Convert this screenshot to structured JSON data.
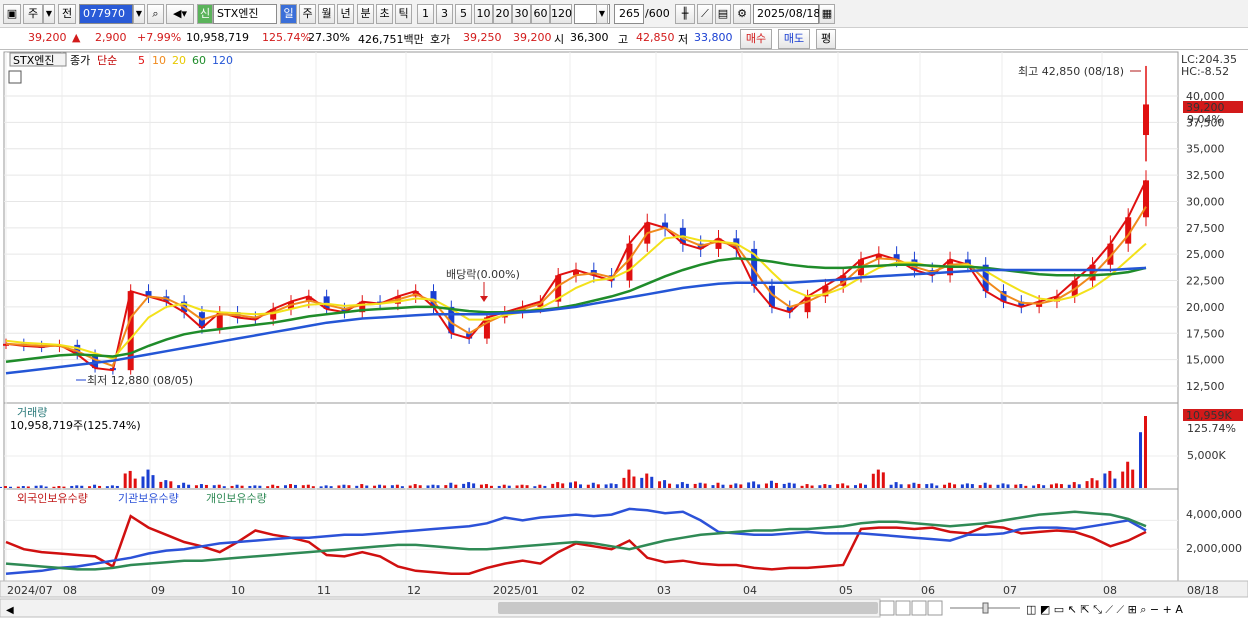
{
  "toolbar": {
    "period_labels": [
      "주",
      "전"
    ],
    "code": "077970",
    "badge": "신",
    "stock_name": "STX엔진",
    "timeframes": [
      "일",
      "주",
      "월",
      "년",
      "분",
      "초",
      "틱"
    ],
    "intervals": [
      "1",
      "3",
      "5",
      "10",
      "20",
      "30",
      "60",
      "120"
    ],
    "count": "265",
    "count_max": "/600",
    "date": "2025/08/18"
  },
  "quote": {
    "price": "39,200",
    "change": "2,900",
    "change_pct": "+7.99%",
    "volume": "10,958,719",
    "volume_ratio": "125.74%",
    "turnover": "27.30%",
    "amount": "426,751백만",
    "bid_label": "호가",
    "bid1": "39,250",
    "bid2": "39,200",
    "open_label": "시",
    "open": "36,300",
    "high_label": "고",
    "high": "42,850",
    "low_label": "저",
    "low": "33,800",
    "buy_label": "매수",
    "sell_label": "매도",
    "eval_label": "평"
  },
  "colors": {
    "ma5": "#e01010",
    "ma10": "#f08a1c",
    "ma20": "#f3e11a",
    "ma60": "#1f8c2a",
    "ma120": "#2456d6",
    "foreign": "#d01010",
    "institution": "#2c52d8",
    "individual": "#2f8a55",
    "up": "#e01010",
    "down": "#1a3fd2"
  },
  "chart_data": [
    {
      "type": "line",
      "title": "STX엔진",
      "legend": [
        "종가",
        "단순",
        "5",
        "10",
        "20",
        "60",
        "120"
      ],
      "price_label_right": "39,200",
      "pct_label_right": "9.04%",
      "lc_label": "LC:204.35",
      "hc_label": "HC:-8.52",
      "y_ticks": [
        "40,000",
        "37,500",
        "35,000",
        "32,500",
        "30,000",
        "27,500",
        "25,000",
        "22,500",
        "20,000",
        "17,500",
        "15,000",
        "12,500"
      ],
      "ylim": [
        10000,
        44000
      ],
      "annotations": {
        "high": "최고 42,850 (08/18)",
        "low": "최저 12,880 (08/05)",
        "dividend": "배당락(0.00%)"
      },
      "x_ticks": [
        "2024/07",
        "08",
        "09",
        "10",
        "11",
        "12",
        "2025/01",
        "02",
        "03",
        "04",
        "05",
        "06",
        "07",
        "08",
        "08/18"
      ],
      "series": [
        {
          "name": "5",
          "values": [
            16500,
            16300,
            16200,
            16400,
            15500,
            14200,
            14000,
            21500,
            21000,
            20500,
            19500,
            18000,
            19500,
            19000,
            18800,
            19800,
            20500,
            21000,
            19800,
            19500,
            20500,
            20300,
            21000,
            21500,
            20000,
            17500,
            17000,
            19000,
            19500,
            20000,
            20500,
            23000,
            23500,
            23000,
            22500,
            26000,
            28000,
            27500,
            26000,
            25500,
            26500,
            25500,
            22000,
            20000,
            19500,
            21000,
            22000,
            23000,
            24500,
            25000,
            24500,
            23500,
            23000,
            24500,
            24000,
            21500,
            20500,
            20000,
            20500,
            21000,
            22500,
            24000,
            26000,
            28500,
            32000
          ]
        },
        {
          "name": "10",
          "values": [
            16500,
            16400,
            16300,
            16300,
            15800,
            15000,
            14400,
            19000,
            21000,
            20800,
            20000,
            18800,
            19300,
            19200,
            19000,
            19500,
            20200,
            20600,
            20200,
            19800,
            20200,
            20300,
            20700,
            21200,
            20500,
            18500,
            17500,
            18500,
            19300,
            19800,
            20300,
            22000,
            23000,
            23200,
            22800,
            24500,
            27000,
            27500,
            26500,
            25800,
            26200,
            25800,
            23500,
            21200,
            20000,
            20500,
            21300,
            22300,
            23800,
            24600,
            24500,
            23800,
            23300,
            24000,
            24100,
            22500,
            21200,
            20400,
            20300,
            20700,
            21700,
            23000,
            24800,
            26800,
            29500
          ]
        },
        {
          "name": "20",
          "values": [
            16800,
            16600,
            16500,
            16400,
            16100,
            15600,
            15100,
            17000,
            19000,
            20000,
            20300,
            19700,
            19500,
            19400,
            19300,
            19400,
            19800,
            20200,
            20300,
            20100,
            20200,
            20300,
            20500,
            20800,
            20700,
            19800,
            18800,
            18800,
            19200,
            19500,
            19900,
            20800,
            21800,
            22500,
            22700,
            23500,
            25000,
            26500,
            26700,
            26300,
            26200,
            26000,
            25000,
            23300,
            21700,
            21000,
            21200,
            21800,
            22800,
            23700,
            24200,
            24200,
            23800,
            23800,
            24000,
            23400,
            22400,
            21500,
            20800,
            20600,
            21000,
            21800,
            23000,
            24500,
            26000
          ]
        },
        {
          "name": "60",
          "values": [
            14800,
            15000,
            15200,
            15400,
            15500,
            15400,
            15300,
            15600,
            16300,
            16900,
            17400,
            17700,
            17900,
            18100,
            18300,
            18500,
            18800,
            19100,
            19300,
            19500,
            19700,
            19800,
            19900,
            20000,
            20000,
            19800,
            19600,
            19500,
            19500,
            19600,
            19700,
            19900,
            20200,
            20600,
            21000,
            21500,
            22200,
            22900,
            23500,
            24000,
            24400,
            24600,
            24500,
            24300,
            24000,
            23800,
            23700,
            23700,
            23800,
            23900,
            24000,
            24000,
            23900,
            23800,
            23800,
            23700,
            23500,
            23300,
            23100,
            23000,
            23000,
            23000,
            23100,
            23300,
            23700
          ]
        },
        {
          "name": "120",
          "values": [
            13700,
            13900,
            14100,
            14300,
            14500,
            14700,
            14900,
            15200,
            15500,
            15800,
            16100,
            16400,
            16700,
            17000,
            17300,
            17600,
            17900,
            18200,
            18500,
            18700,
            18900,
            19000,
            19100,
            19200,
            19300,
            19300,
            19300,
            19300,
            19400,
            19500,
            19600,
            19800,
            20000,
            20300,
            20600,
            20900,
            21200,
            21500,
            21800,
            22000,
            22200,
            22300,
            22300,
            22300,
            22300,
            22400,
            22500,
            22600,
            22800,
            22900,
            23000,
            23100,
            23200,
            23300,
            23400,
            23500,
            23500,
            23500,
            23500,
            23500,
            23500,
            23500,
            23500,
            23600,
            23700
          ]
        }
      ]
    },
    {
      "type": "bar",
      "title": "거래량",
      "subtitle": "10,958,719주(125.74%)",
      "right_value": "10,959K",
      "right_pct": "125.74%",
      "y_ticks": [
        "5,000K"
      ],
      "ylim": [
        0,
        10959000
      ],
      "values": [
        0.3,
        0.3,
        0.4,
        0.3,
        0.4,
        0.5,
        0.4,
        2.6,
        2.8,
        1.2,
        0.8,
        0.6,
        0.5,
        0.5,
        0.4,
        0.5,
        0.6,
        0.5,
        0.4,
        0.5,
        0.6,
        0.5,
        0.5,
        0.6,
        0.5,
        0.8,
        0.9,
        0.6,
        0.5,
        0.5,
        0.5,
        0.9,
        1.0,
        0.8,
        0.7,
        2.8,
        2.2,
        1.2,
        0.9,
        0.8,
        0.8,
        0.7,
        1.0,
        1.1,
        0.8,
        0.6,
        0.6,
        0.7,
        0.7,
        2.8,
        0.9,
        0.8,
        0.7,
        0.8,
        0.7,
        0.8,
        0.7,
        0.6,
        0.6,
        0.7,
        0.9,
        1.5,
        2.6,
        4.0,
        10.96
      ]
    },
    {
      "type": "line",
      "title": "외국인보유수량",
      "legend": [
        "외국인보유수량",
        "기관보유수량",
        "개인보유수량"
      ],
      "y_ticks": [
        "4,000,000",
        "2,000,000"
      ],
      "ylim": [
        0,
        5000000
      ],
      "series": [
        {
          "name": "외국인보유수량",
          "values": [
            2500000,
            2000000,
            1800000,
            1700000,
            1600000,
            1500000,
            800000,
            4300000,
            3500000,
            3000000,
            2500000,
            2200000,
            1800000,
            2500000,
            3300000,
            3000000,
            2800000,
            2500000,
            1600000,
            1500000,
            1800000,
            1500000,
            800000,
            500000,
            400000,
            300000,
            300000,
            700000,
            1000000,
            1200000,
            1000000,
            1800000,
            2400000,
            2200000,
            2000000,
            2600000,
            1400000,
            1100000,
            1200000,
            1000000,
            900000,
            900000,
            700000,
            600000,
            700000,
            700000,
            800000,
            900000,
            3400000,
            3500000,
            3500000,
            3400000,
            3500000,
            3200000,
            3100000,
            3600000,
            3500000,
            3100000,
            3200000,
            3300000,
            3200000,
            2800000,
            2200000,
            2600000,
            3200000
          ]
        },
        {
          "name": "기관보유수량",
          "values": [
            300000,
            400000,
            500000,
            700000,
            800000,
            1000000,
            1200000,
            1400000,
            1700000,
            1900000,
            2000000,
            2200000,
            2400000,
            2500000,
            2600000,
            2700000,
            2800000,
            2800000,
            2900000,
            3000000,
            3000000,
            3100000,
            3200000,
            3300000,
            3400000,
            3500000,
            3600000,
            3800000,
            4200000,
            4000000,
            4200000,
            4300000,
            4400000,
            4300000,
            4400000,
            4800000,
            4700000,
            4500000,
            4600000,
            4000000,
            3200000,
            3100000,
            3000000,
            3000000,
            3100000,
            3200000,
            3100000,
            3100000,
            3100000,
            3000000,
            2900000,
            2800000,
            2700000,
            2600000,
            3000000,
            3000000,
            3100000,
            3400000,
            3500000,
            3500000,
            3400000,
            3600000,
            3800000,
            4000000,
            3300000
          ]
        },
        {
          "name": "개인보유수량",
          "values": [
            1000000,
            900000,
            800000,
            700000,
            600000,
            600000,
            700000,
            900000,
            1000000,
            1100000,
            1200000,
            1200000,
            1300000,
            1400000,
            1500000,
            1600000,
            1700000,
            1800000,
            1900000,
            2000000,
            2100000,
            2200000,
            2300000,
            2300000,
            2200000,
            2100000,
            2000000,
            2000000,
            2100000,
            2200000,
            2300000,
            2400000,
            2500000,
            2400000,
            2200000,
            2000000,
            2300000,
            2600000,
            2800000,
            3000000,
            3100000,
            3200000,
            3300000,
            3300000,
            3400000,
            3400000,
            3500000,
            3600000,
            3800000,
            3900000,
            3900000,
            3800000,
            3700000,
            3600000,
            3700000,
            3800000,
            4000000,
            4200000,
            4400000,
            4500000,
            4600000,
            4500000,
            4400000,
            4100000,
            3600000
          ]
        }
      ]
    }
  ],
  "status": {
    "candle_count_note": ""
  }
}
